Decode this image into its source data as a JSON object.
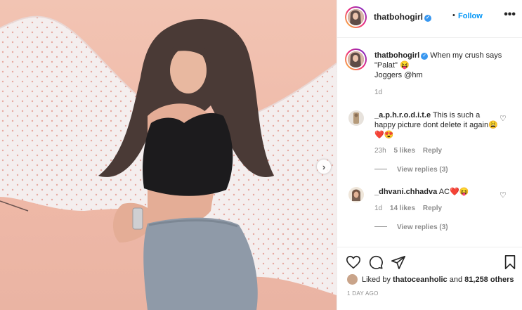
{
  "post": {
    "author": "thatbohogirl",
    "follow_label": "Follow",
    "separator": "•",
    "more_label": "•••",
    "next_arrow": "›"
  },
  "caption": {
    "author": "thatbohogirl",
    "text_line1": "When my crush says",
    "text_line2": "\"Palat\" 😝",
    "text_line3": "Joggers @hm",
    "time": "1d"
  },
  "comments": [
    {
      "author": "_a.p.h.r.o.d.i.t.e",
      "text": "This is such a happy picture dont delete it again😩❤️😍",
      "time": "23h",
      "likes": "5 likes",
      "reply": "Reply",
      "view_replies": "View replies (3)"
    },
    {
      "author": "_dhvani.chhadva",
      "text": "AC❤️😝",
      "time": "1d",
      "likes": "14 likes",
      "reply": "Reply",
      "view_replies": "View replies (3)"
    }
  ],
  "likes_summary": {
    "prefix": "Liked by",
    "user": "thatoceanholic",
    "suffix": "and",
    "count": "81,258 others"
  },
  "timestamp": "1 DAY AGO",
  "icons": {
    "like": "heart-icon",
    "comment": "comment-icon",
    "share": "paper-plane-icon",
    "save": "bookmark-icon",
    "verified": "verified-badge-icon"
  },
  "colors": {
    "accent": "#0095f6",
    "verified": "#3897f0",
    "meta": "#8e8e8e",
    "photo_wall": "#efb9a8"
  }
}
